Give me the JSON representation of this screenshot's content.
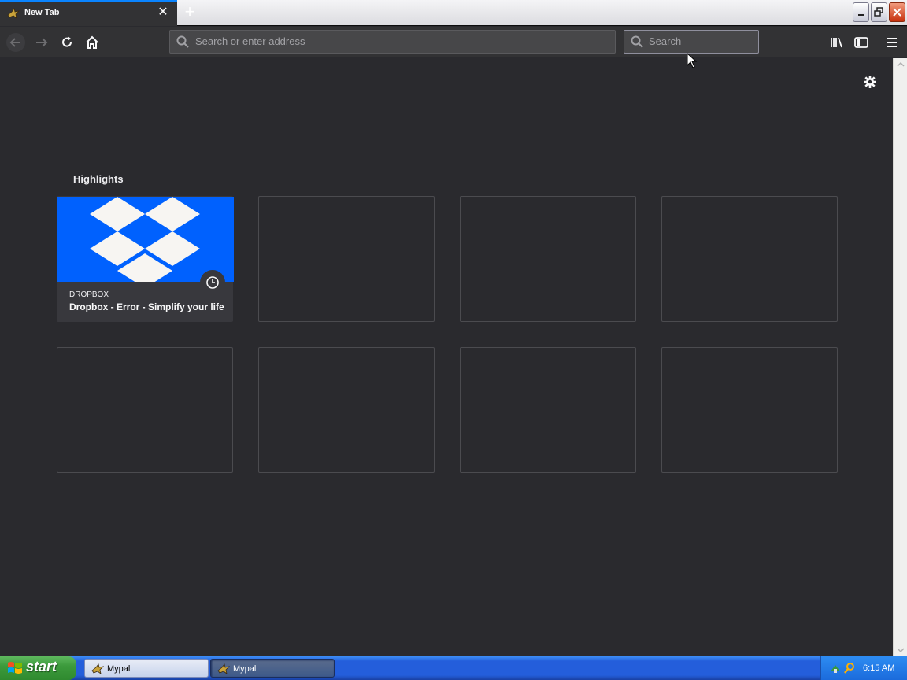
{
  "browser": {
    "tab": {
      "title": "New Tab",
      "icon": "mypal-bird-icon"
    },
    "toolbar": {
      "url_placeholder": "Search or enter address",
      "search_placeholder": "Search"
    }
  },
  "newtab": {
    "section_title": "Highlights",
    "highlight_cards": [
      {
        "host": "DROPBOX",
        "title": "Dropbox - Error - Simplify your life",
        "thumbnail_color": "#0061fe",
        "badge_icon": "clock-icon"
      }
    ],
    "empty_card_count": 7
  },
  "taskbar": {
    "start_label": "start",
    "tasks": [
      {
        "label": "Mypal"
      },
      {
        "label": "Mypal"
      }
    ],
    "clock": "6:15 AM"
  },
  "colors": {
    "accent": "#0a84ff",
    "background": "#2a2a2e",
    "dropbox_blue": "#0061fe"
  }
}
